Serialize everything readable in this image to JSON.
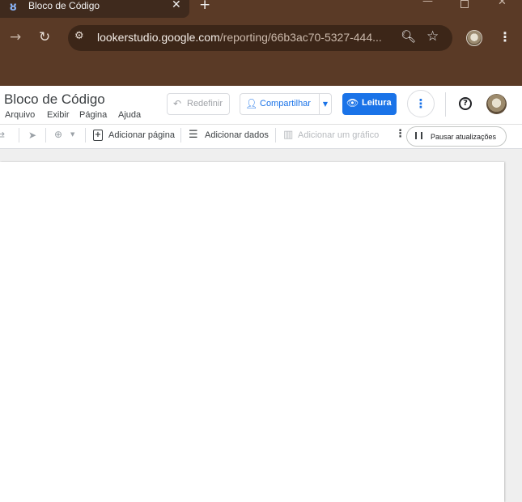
{
  "browser": {
    "tab_title": "Bloco de Código",
    "tab_favicon": "looker-studio-icon",
    "url_host": "lookerstudio.google.com",
    "url_path": "/reporting/66b3ac70-5327-444...",
    "colors": {
      "frame": "#5a3a26",
      "omnibox": "#3c2618"
    }
  },
  "header": {
    "title": "Bloco de Código",
    "menu": [
      "Arquivo",
      "Exibir",
      "Página",
      "Ajuda"
    ],
    "reset_label": "Redefinir",
    "share_label": "Compartilhar",
    "view_label": "Leitura",
    "accent": "#1a73e8"
  },
  "toolbar": {
    "add_page_label": "Adicionar página",
    "add_data_label": "Adicionar dados",
    "add_chart_label": "Adicionar um gráfico",
    "pause_label": "Pausar atualizações"
  },
  "icons": [
    "forward-icon",
    "reload-icon",
    "site-info-icon",
    "zoom-icon",
    "star-icon",
    "undo-icon",
    "person-add-icon",
    "eye-icon",
    "more-vert-icon",
    "help-icon",
    "select-icon",
    "zoom-in-icon",
    "add-page-icon",
    "add-data-icon",
    "add-chart-icon",
    "pause-icon"
  ]
}
